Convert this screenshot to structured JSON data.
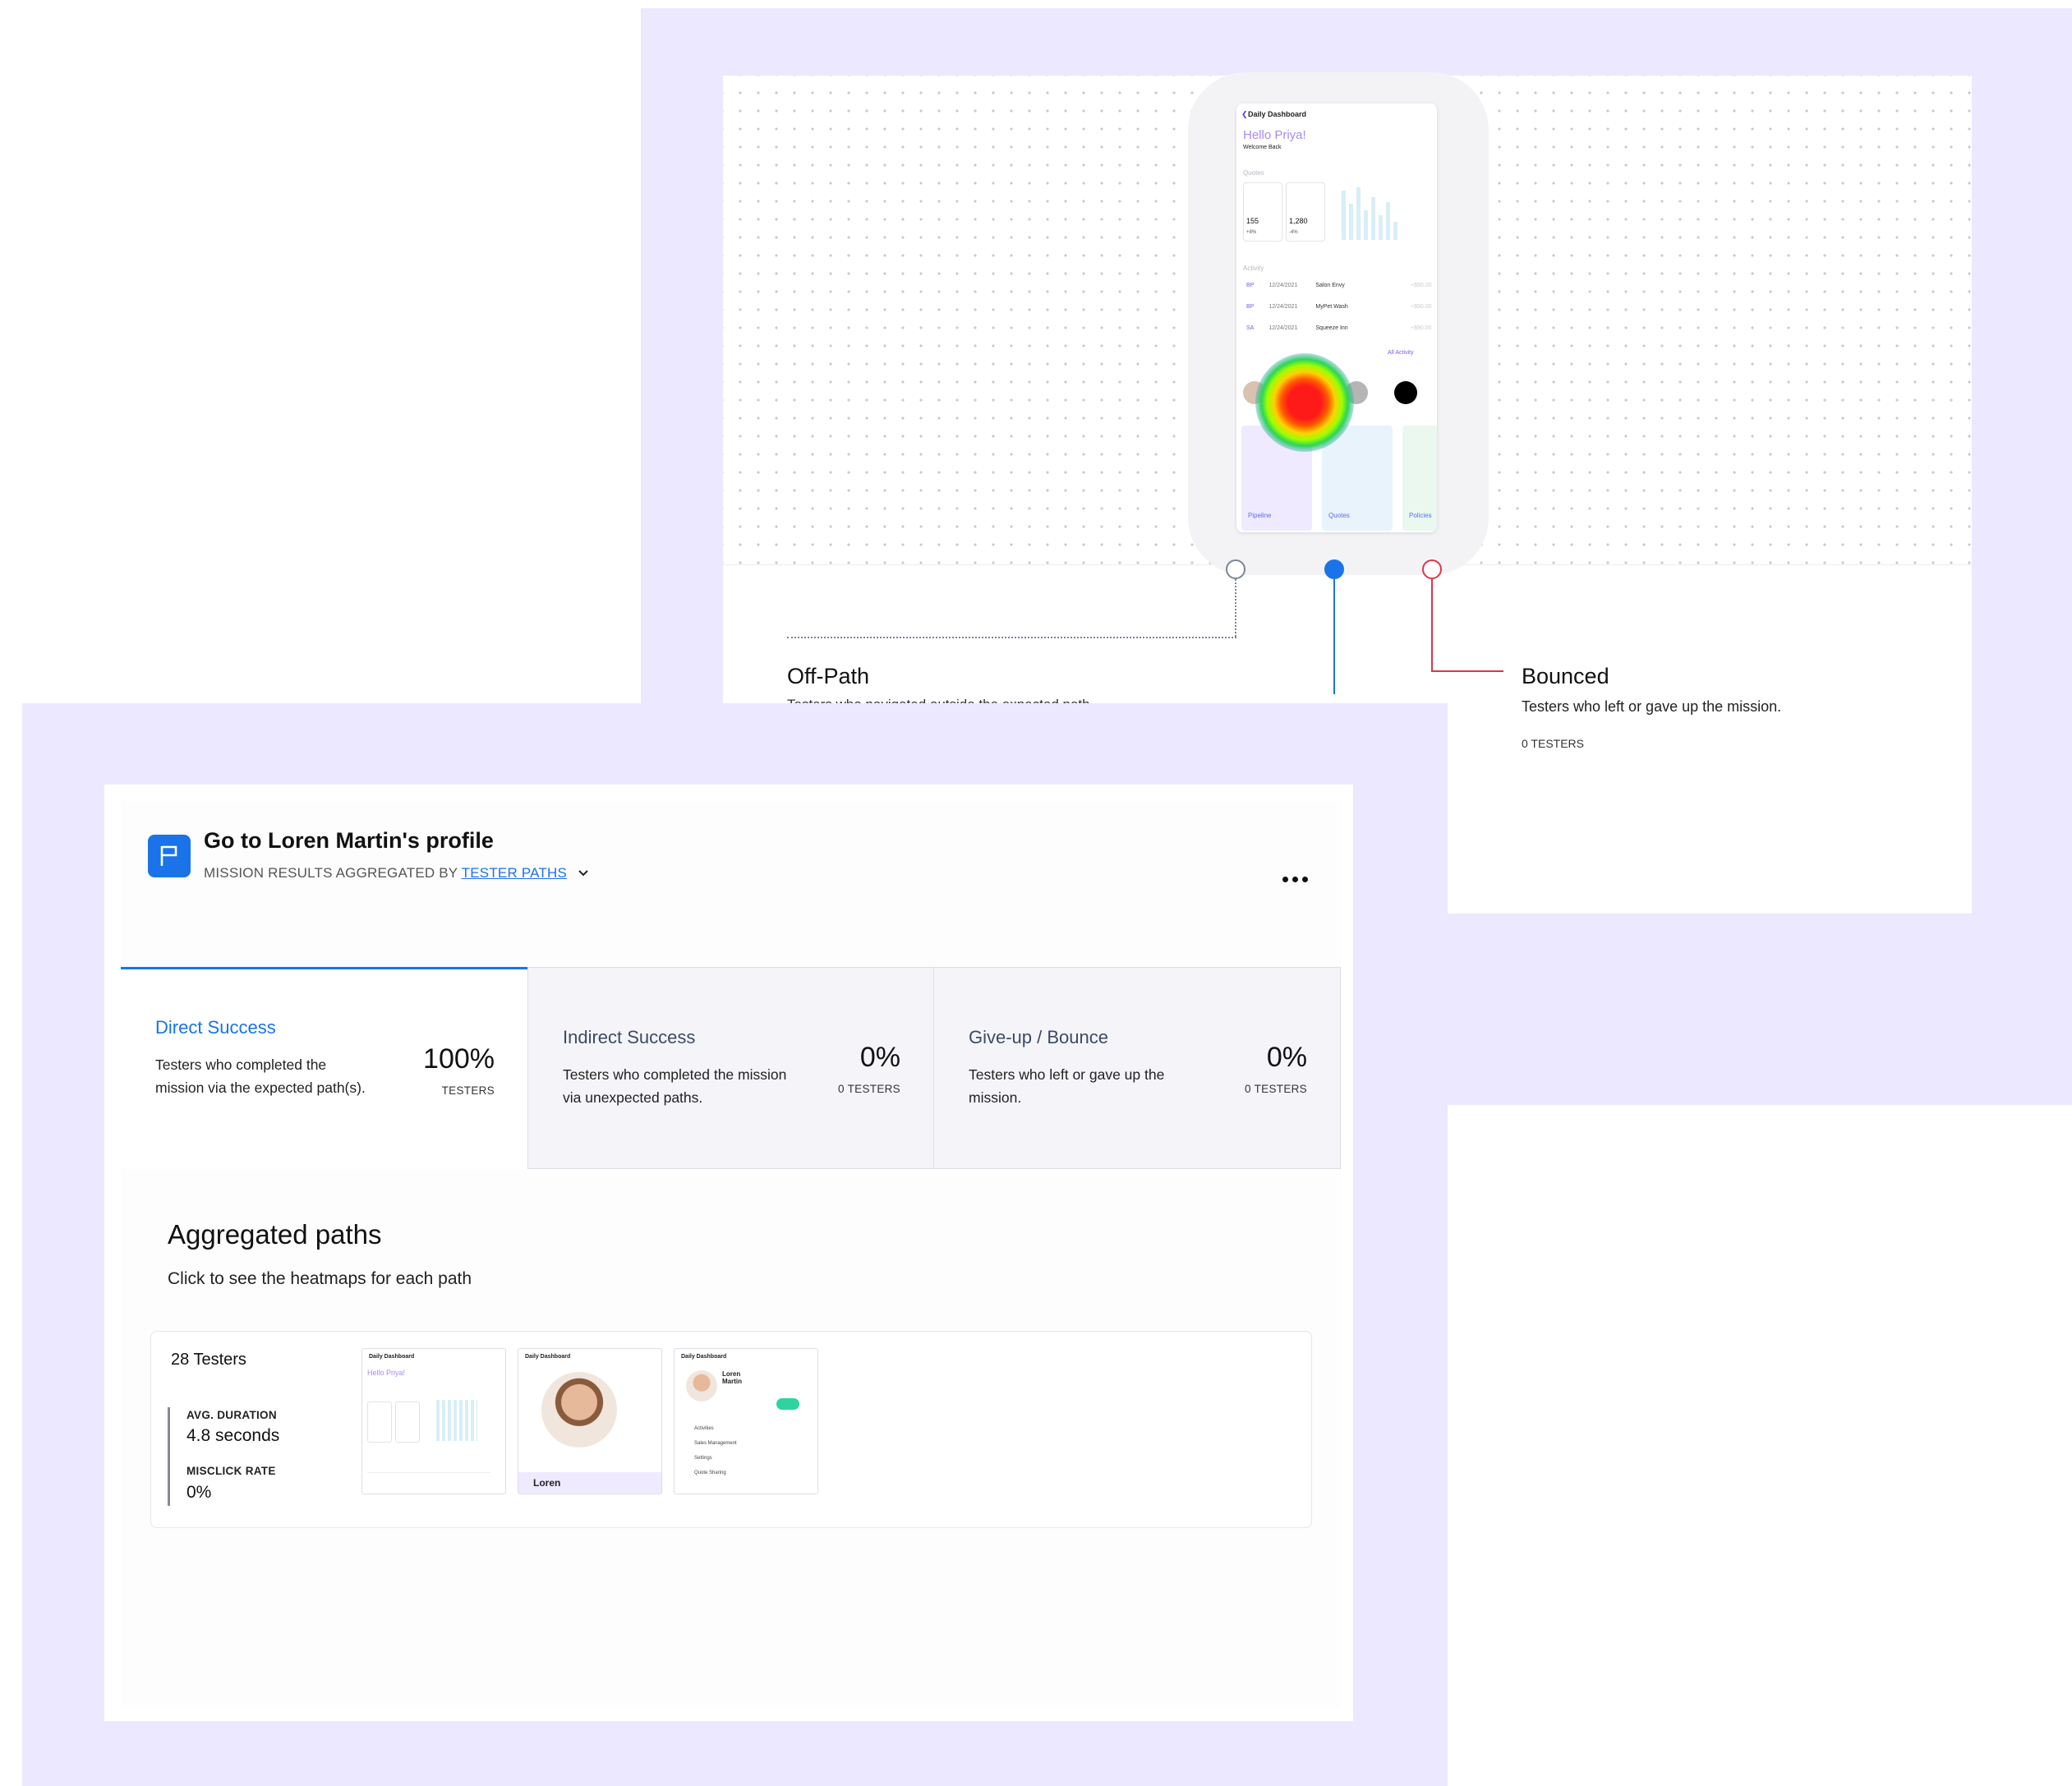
{
  "flow": {
    "phone": {
      "title": "Daily Dashboard",
      "greeting": "Hello Priya!",
      "welcome": "Welcome Back",
      "quotes_label": "Quotes",
      "stat1_value": "155",
      "stat1_change": "+8%",
      "stat2_value": "1,280",
      "stat2_change": "-4%",
      "activity_label": "Activity",
      "activity": [
        {
          "initials": "BP",
          "date": "12/24/2021",
          "name": "Salon Envy",
          "amount": "+$90.00"
        },
        {
          "initials": "BP",
          "date": "12/24/2021",
          "name": "MyPet Wash",
          "amount": "+$90.00"
        },
        {
          "initials": "SA",
          "date": "12/24/2021",
          "name": "Squeeze Inn",
          "amount": "+$90.00"
        }
      ],
      "all_activity": "All Activity",
      "tiles": [
        "Pipeline",
        "Quotes",
        "Policies"
      ],
      "tile_colors": [
        "#efeaff",
        "#e9f3fc",
        "#eaf8f0"
      ]
    },
    "off_path": {
      "title": "Off-Path",
      "description": "Testers who navigated outside the expected path."
    },
    "bounced": {
      "title": "Bounced",
      "description": "Testers who left or gave up the mission.",
      "count": "0 TESTERS"
    },
    "node_colors": {
      "off_path": "#7a8596",
      "direct": "#1a73e8",
      "bounced": "#e0344a"
    }
  },
  "mission": {
    "title": "Go to Loren Martin's profile",
    "subtitle_prefix": "MISSION RESULTS AGGREGATED BY",
    "subtitle_link": "TESTER PATHS",
    "more_icon": "more-horizontal-icon",
    "flag_icon": "flag-icon"
  },
  "stats": [
    {
      "title": "Direct Success",
      "description": "Testers who completed the mission via the expected path(s).",
      "percent": "100%",
      "unit": "TESTERS"
    },
    {
      "title": "Indirect Success",
      "description": "Testers who completed the mission via unexpected paths.",
      "percent": "0%",
      "unit": "0 TESTERS"
    },
    {
      "title": "Give-up / Bounce",
      "description": "Testers who left or gave up the mission.",
      "percent": "0%",
      "unit": "0 TESTERS"
    }
  ],
  "aggregated": {
    "title": "Aggregated paths",
    "subtitle": "Click to see the heatmaps for each path",
    "path": {
      "testers": "28 Testers",
      "avg_duration_label": "AVG. DURATION",
      "avg_duration": "4.8 seconds",
      "misclick_label": "MISCLICK RATE",
      "misclick": "0%",
      "thumb_title": "Daily Dashboard",
      "thumb1_greeting": "Hello Priya!",
      "thumb2_name": "Loren",
      "thumb3_name": "Loren Martin",
      "thumb3_menu": [
        "Activities",
        "Sales Management",
        "Settings",
        "Quote Sharing"
      ]
    }
  },
  "colors": {
    "accent": "#1a73e8",
    "panel_bg": "#ece8ff"
  }
}
